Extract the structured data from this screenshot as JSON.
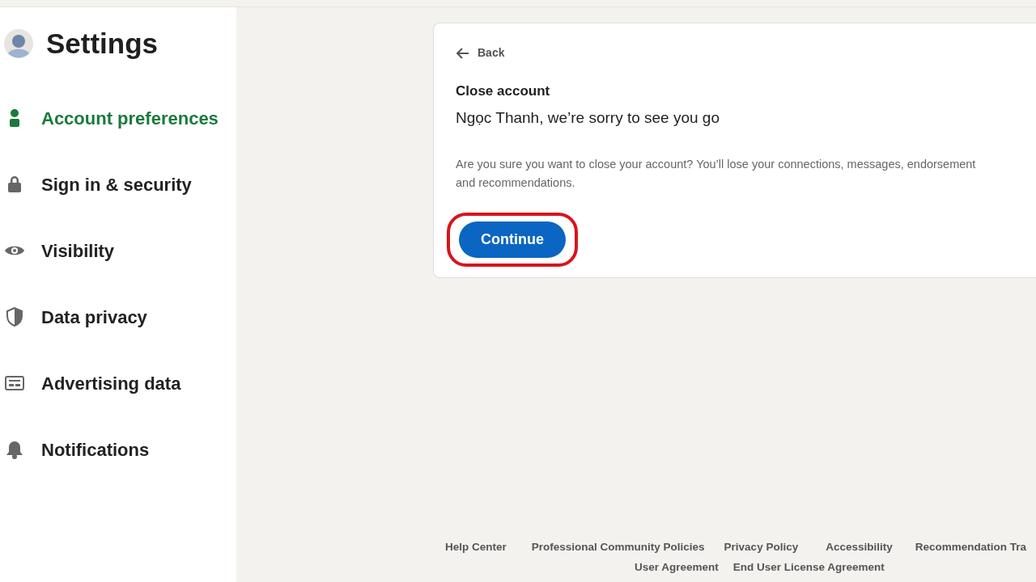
{
  "sidebar": {
    "title": "Settings",
    "items": [
      {
        "label": "Account preferences",
        "selected": true
      },
      {
        "label": "Sign in & security",
        "selected": false
      },
      {
        "label": "Visibility",
        "selected": false
      },
      {
        "label": "Data privacy",
        "selected": false
      },
      {
        "label": "Advertising data",
        "selected": false
      },
      {
        "label": "Notifications",
        "selected": false
      }
    ]
  },
  "card": {
    "back": "Back",
    "heading": "Close account",
    "subheading": "Ngọc Thanh, we’re sorry to see you go",
    "message": "Are you sure you want to close your account? You’ll lose your connections, messages, endorsement\nand recommendations.",
    "button": {
      "label": "Continue",
      "highlighted": true
    }
  },
  "footer": {
    "links": [
      "Help Center",
      "Professional Community Policies",
      "Privacy Policy",
      "Accessibility",
      "Recommendation Tra"
    ],
    "secondary_links": [
      "User Agreement",
      "End User License Agreement"
    ]
  }
}
